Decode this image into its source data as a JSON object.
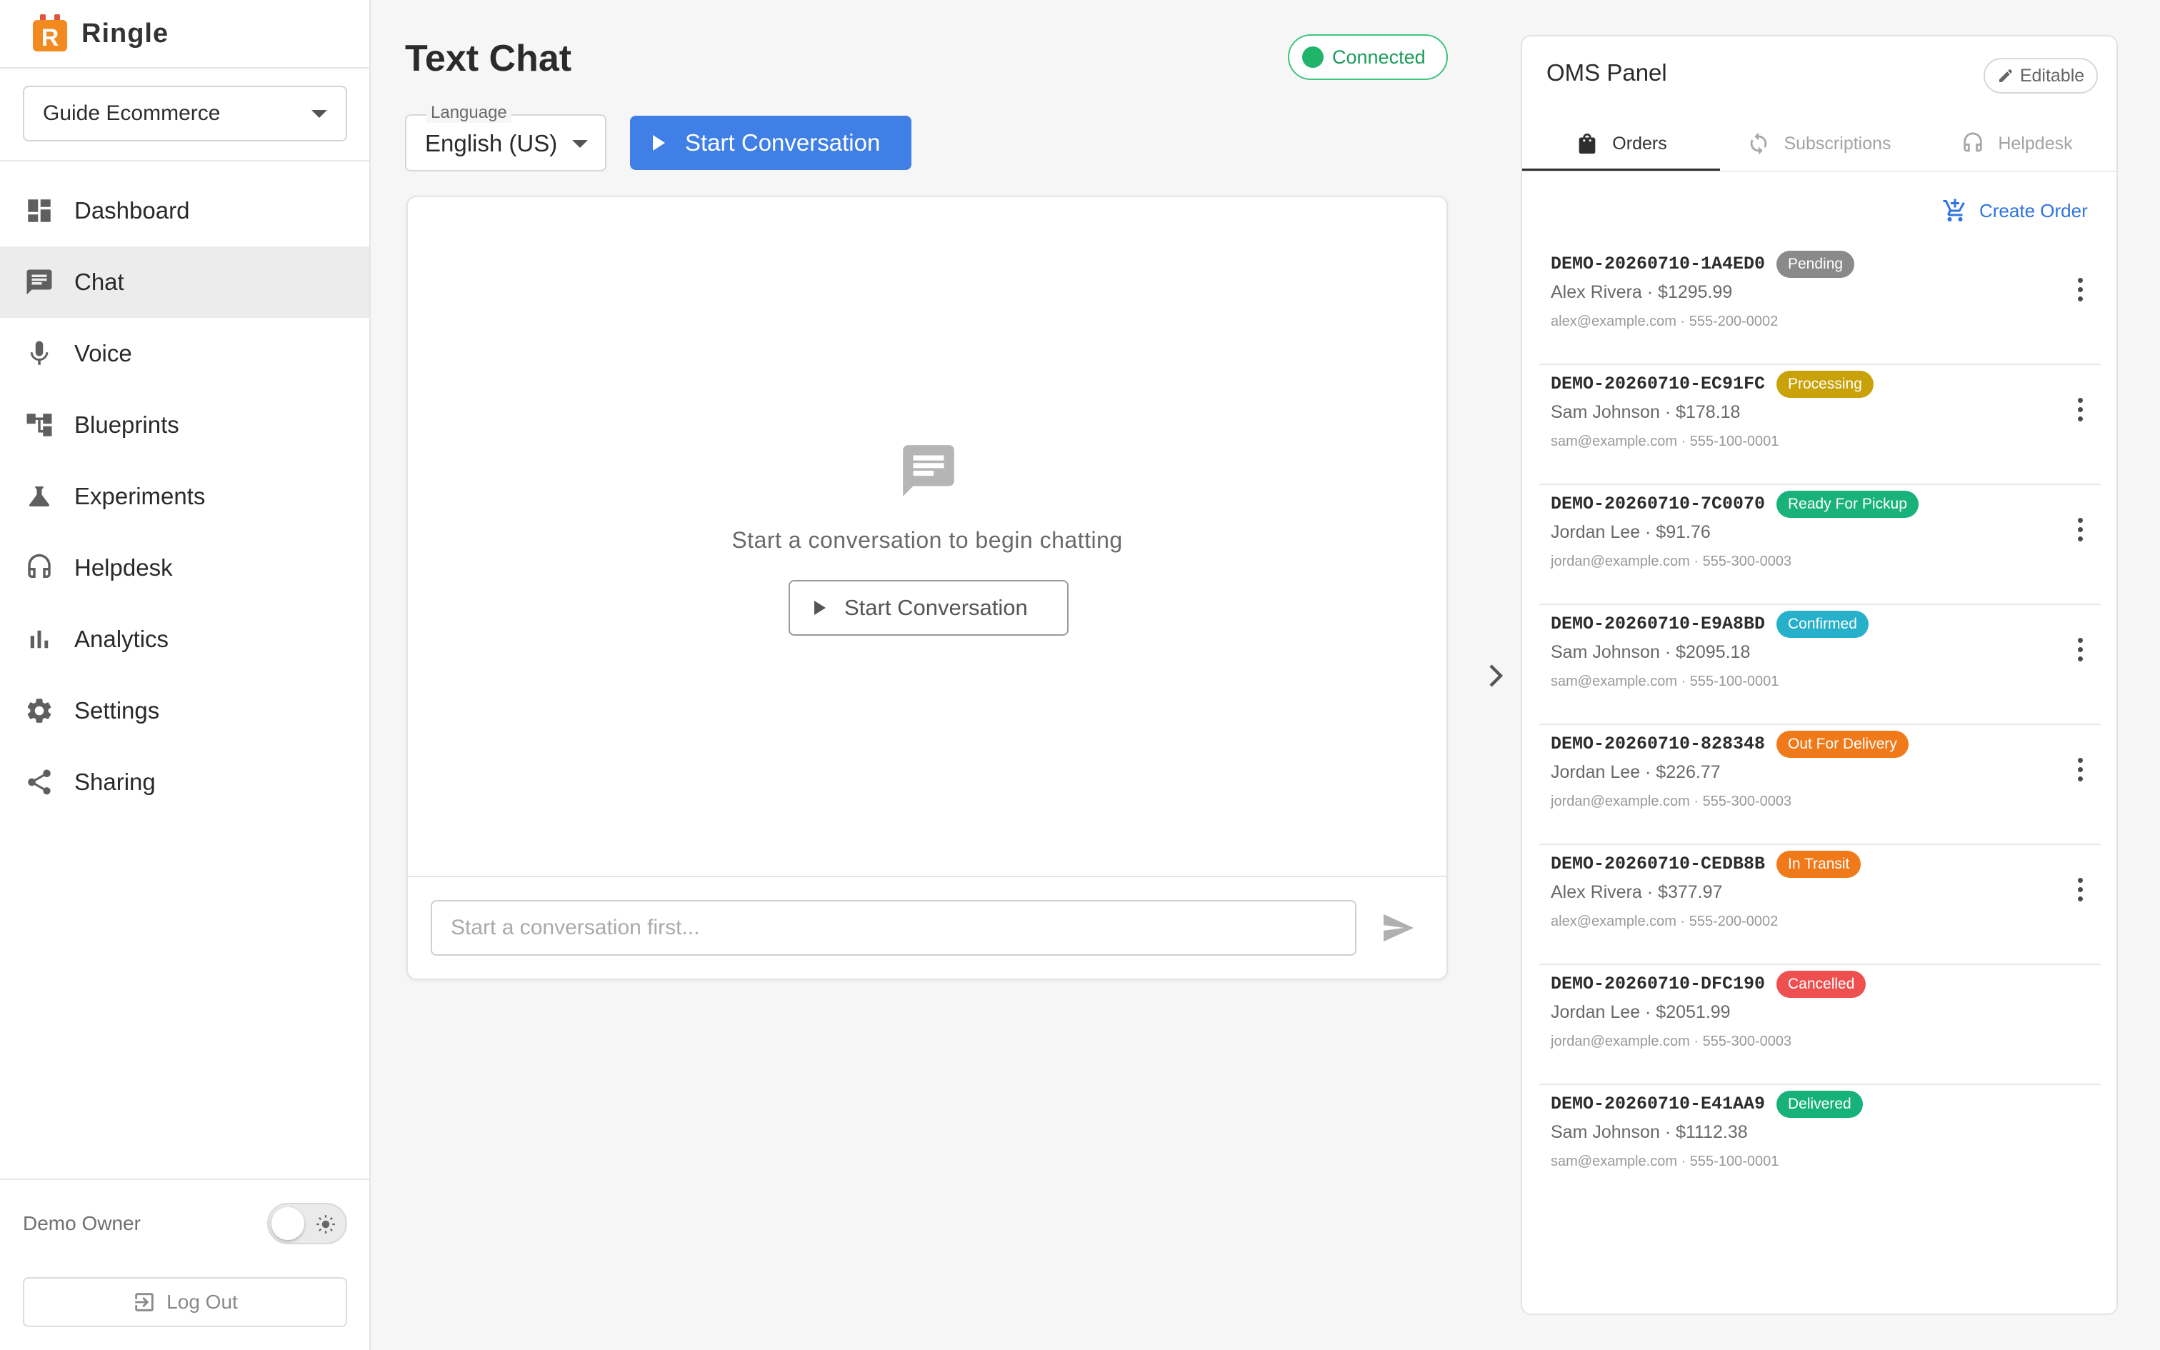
{
  "brand": {
    "name": "Ringle",
    "logo_letter": "R",
    "logo_color": "#f28a1f"
  },
  "sidebar": {
    "org_select": "Guide Ecommerce",
    "items": [
      {
        "label": "Dashboard",
        "icon": "dashboard-icon",
        "active": false
      },
      {
        "label": "Chat",
        "icon": "chat-icon",
        "active": true
      },
      {
        "label": "Voice",
        "icon": "microphone-icon",
        "active": false
      },
      {
        "label": "Blueprints",
        "icon": "blueprints-icon",
        "active": false
      },
      {
        "label": "Experiments",
        "icon": "flask-icon",
        "active": false
      },
      {
        "label": "Helpdesk",
        "icon": "headset-icon",
        "active": false
      },
      {
        "label": "Analytics",
        "icon": "bar-chart-icon",
        "active": false
      },
      {
        "label": "Settings",
        "icon": "gear-icon",
        "active": false
      },
      {
        "label": "Sharing",
        "icon": "share-icon",
        "active": false
      }
    ],
    "user_name": "Demo Owner",
    "logout_label": "Log Out"
  },
  "main": {
    "title": "Text Chat",
    "status": "Connected",
    "language_label": "Language",
    "language_value": "English (US)",
    "start_button": "Start Conversation",
    "empty_text": "Start a conversation to begin chatting",
    "empty_button": "Start Conversation",
    "input_placeholder": "Start a conversation first..."
  },
  "oms": {
    "title": "OMS Panel",
    "editable_label": "Editable",
    "tabs": [
      {
        "label": "Orders",
        "icon": "shopping-bag-icon",
        "active": true
      },
      {
        "label": "Subscriptions",
        "icon": "refresh-icon",
        "active": false
      },
      {
        "label": "Helpdesk",
        "icon": "headset-icon",
        "active": false
      }
    ],
    "create_order_label": "Create Order",
    "orders": [
      {
        "id": "DEMO-20260710-1A4ED0",
        "status": "Pending",
        "status_color": "#8a8a8a",
        "customer": "Alex Rivera · $1295.99",
        "contact": "alex@example.com · 555-200-0002"
      },
      {
        "id": "DEMO-20260710-EC91FC",
        "status": "Processing",
        "status_color": "#c9a20a",
        "customer": "Sam Johnson · $178.18",
        "contact": "sam@example.com · 555-100-0001"
      },
      {
        "id": "DEMO-20260710-7C0070",
        "status": "Ready For Pickup",
        "status_color": "#18b27a",
        "customer": "Jordan Lee · $91.76",
        "contact": "jordan@example.com · 555-300-0003"
      },
      {
        "id": "DEMO-20260710-E9A8BD",
        "status": "Confirmed",
        "status_color": "#27b0c9",
        "customer": "Sam Johnson · $2095.18",
        "contact": "sam@example.com · 555-100-0001"
      },
      {
        "id": "DEMO-20260710-828348",
        "status": "Out For Delivery",
        "status_color": "#f07a1a",
        "customer": "Jordan Lee · $226.77",
        "contact": "jordan@example.com · 555-300-0003"
      },
      {
        "id": "DEMO-20260710-CEDB8B",
        "status": "In Transit",
        "status_color": "#f07a1a",
        "customer": "Alex Rivera · $377.97",
        "contact": "alex@example.com · 555-200-0002"
      },
      {
        "id": "DEMO-20260710-DFC190",
        "status": "Cancelled",
        "status_color": "#ee5050",
        "customer": "Jordan Lee · $2051.99",
        "contact": "jordan@example.com · 555-300-0003"
      },
      {
        "id": "DEMO-20260710-E41AA9",
        "status": "Delivered",
        "status_color": "#17b27a",
        "customer": "Sam Johnson · $1112.38",
        "contact": "sam@example.com · 555-100-0001"
      }
    ]
  },
  "colors": {
    "accent": "#3f7fe6",
    "connected": "#1fb46a"
  }
}
